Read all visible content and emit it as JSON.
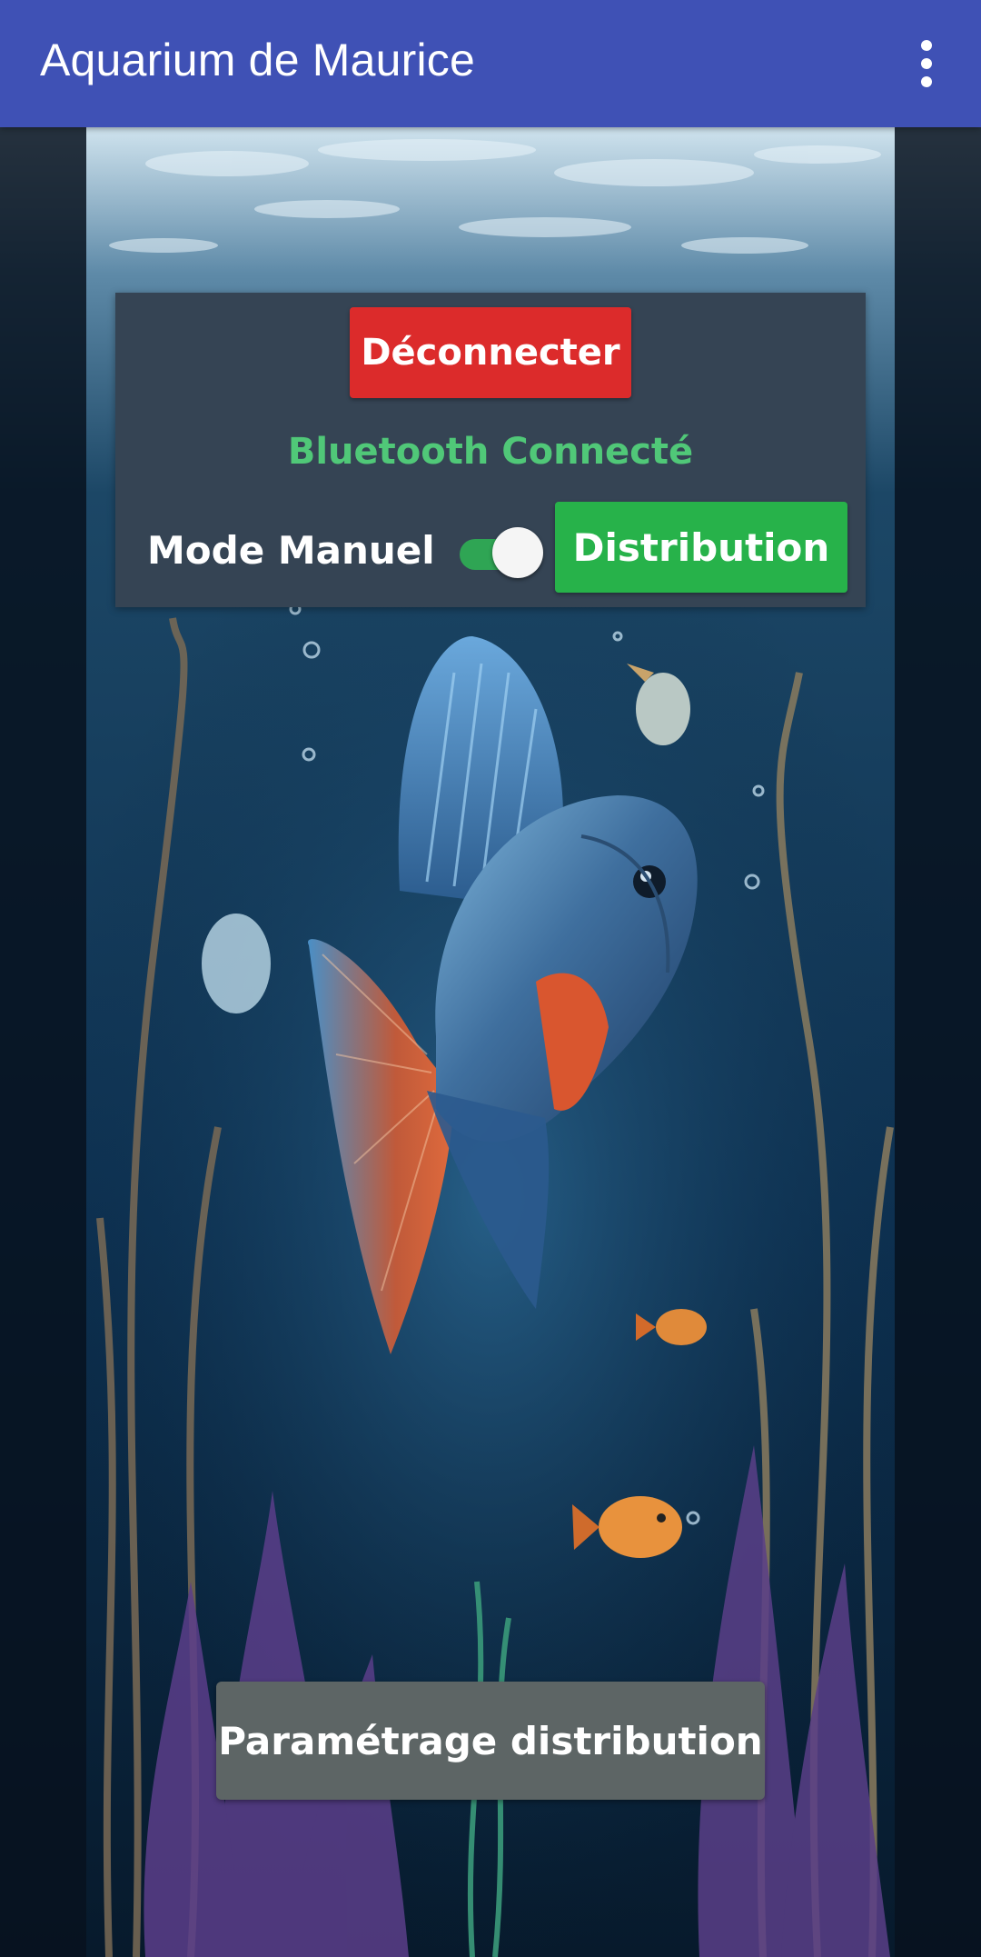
{
  "app_bar": {
    "title": "Aquarium de Maurice",
    "menu_icon": "more-vert-icon",
    "color": "#3f51b5"
  },
  "control_panel": {
    "disconnect_label": "Déconnecter",
    "bluetooth_status": "Bluetooth Connecté",
    "mode_label": "Mode Manuel",
    "manual_mode_on": true,
    "distribution_label": "Distribution"
  },
  "settings_button": {
    "label": "Paramétrage distribution"
  },
  "colors": {
    "disconnect": "#dc2b2b",
    "status": "#50c878",
    "distribution": "#27b24a",
    "card": "#354454",
    "settings": "#5d6565"
  },
  "background": {
    "icon": "aquarium-fish-illustration"
  }
}
